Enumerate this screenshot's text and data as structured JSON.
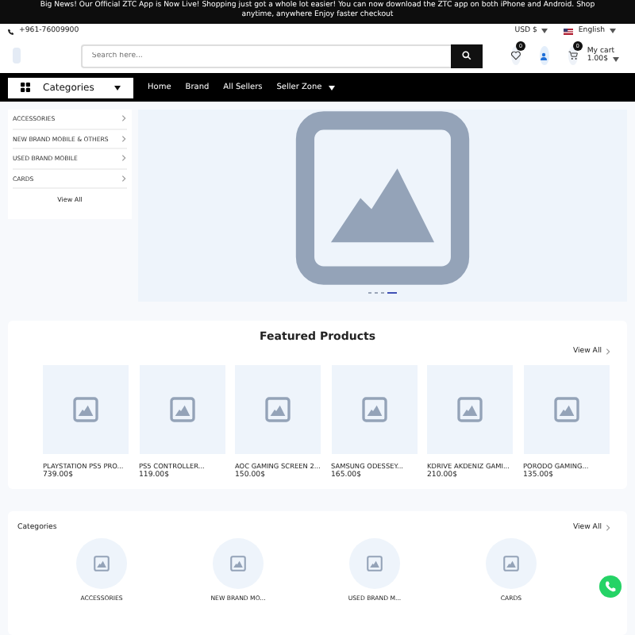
{
  "announcement": "Big News! Our Official ZTC App is Now Live! Shopping just got a whole lot easier! You can now download the ZTC app on both iPhone and Android. Shop anytime, anywhere Enjoy faster checkout",
  "topbar": {
    "phone": "+961-76009900",
    "currency": "USD $",
    "language": "English"
  },
  "header": {
    "search": {
      "placeholder": "Search here..."
    },
    "wishlist_count": "0",
    "cart_count": "0",
    "cart_label": "My cart",
    "cart_total": "1.00$"
  },
  "nav": {
    "categories_label": "Categories",
    "links": [
      {
        "label": "Home",
        "dropdown": false
      },
      {
        "label": "Brand",
        "dropdown": false
      },
      {
        "label": "All Sellers",
        "dropdown": false
      },
      {
        "label": "Seller Zone",
        "dropdown": true
      }
    ]
  },
  "sidebar": {
    "items": [
      "ACCESSORIES",
      "NEW BRAND MOBILE & OTHERS",
      "USED BRAND MOBILE",
      "CARDS"
    ],
    "view_all": "View All"
  },
  "hero": {
    "slides": [
      {
        "selected": false
      },
      {
        "selected": false
      },
      {
        "selected": false
      },
      {
        "selected": true
      }
    ]
  },
  "featured": {
    "title": "Featured Products",
    "view_all": "View All",
    "products": [
      {
        "name": "PLAYSTATION PS5 PRO...",
        "price": "739.00$"
      },
      {
        "name": "PS5 CONTROLLER...",
        "price": "119.00$"
      },
      {
        "name": "AOC GAMING SCREEN 2...",
        "price": "150.00$"
      },
      {
        "name": "SAMSUNG ODESSEY...",
        "price": "165.00$"
      },
      {
        "name": "KDRIVE AKDENIZ GAMI...",
        "price": "210.00$"
      },
      {
        "name": "PORODO GAMING...",
        "price": "135.00$"
      }
    ]
  },
  "categories": {
    "title": "Categories",
    "view_all": "View All",
    "items": [
      "ACCESSORIES",
      "NEW BRAND MO...",
      "USED BRAND M...",
      "CARDS"
    ]
  }
}
